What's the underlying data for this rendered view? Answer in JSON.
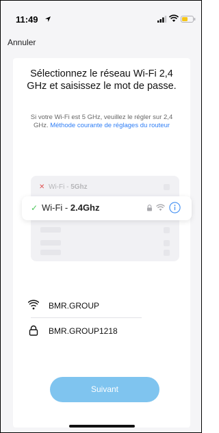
{
  "status_bar": {
    "time": "11:49"
  },
  "nav": {
    "cancel_label": "Annuler"
  },
  "header": {
    "title": "Sélectionnez le réseau Wi-Fi 2,4 GHz et saisissez le mot de passe.",
    "subtitle": "Si votre Wi-Fi est 5 GHz, veuillez le régler sur 2,4 GHz.",
    "help_link": "Méthode courante de réglages du routeur"
  },
  "networks": [
    {
      "prefix": "Wi-Fi - ",
      "band": "5Ghz",
      "status": "unsupported"
    },
    {
      "prefix": "Wi-Fi - ",
      "band": "2.4Ghz",
      "status": "selected"
    }
  ],
  "form": {
    "ssid_value": "BMR.GROUP",
    "password_value": "BMR.GROUP1218"
  },
  "actions": {
    "next_label": "Suivant"
  },
  "colors": {
    "accent": "#2f7ef5",
    "button": "#7fc4ef",
    "check": "#4cc65a",
    "error": "#e05252"
  }
}
